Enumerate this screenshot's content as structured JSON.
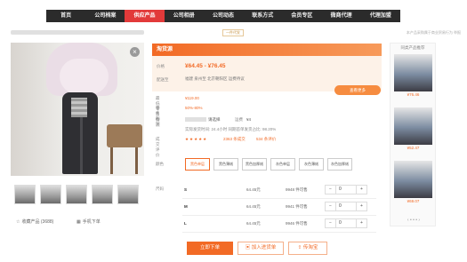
{
  "nav": {
    "items": [
      "首页",
      "公司档案",
      "供应产品",
      "公司相册",
      "公司动态",
      "联系方式",
      "会员专区",
      "微商代理",
      "代理加盟"
    ],
    "active_index": 2,
    "active_color": "#e23a3a",
    "bar_color": "#2b2b2b"
  },
  "breadcrumb": {
    "brand_tag": "一件代发",
    "right_text": "本产品采购属于商业贸易行为    举报"
  },
  "product": {
    "title": "淘货源",
    "price_label": "价格",
    "price": "¥64.45 - ¥76.45",
    "ship_label": "配送至",
    "ship_text": "福建 泉州至 北京朝阳区 运费待议",
    "see_more": "查看更多",
    "close_icon": "close-icon",
    "accent_color": "#f26a25"
  },
  "info_rows": {
    "min_price_label": "最低零售价",
    "min_price_value": "¥119.00",
    "margin_label": "零售利润",
    "margin_value": "50%-80%",
    "stock_label": "物流",
    "stock_value": "请选择",
    "freight_label": "运费",
    "freight_value": "¥4",
    "ship_speed": "实际发货时间: 24.4小时    同期首单发货占比: 98.20%",
    "rating_label": "成交评价",
    "rating_stars": "★★★★★",
    "sold_count": "2363 条成交",
    "review_count": "534 条评价"
  },
  "colors": {
    "label": "颜色",
    "options": [
      "黑色单层",
      "黑色薄绒",
      "黑色加厚绒",
      "灰色单层",
      "灰色薄绒",
      "灰色加厚绒"
    ],
    "selected_index": 0
  },
  "sizes": {
    "label": "尺码",
    "rows": [
      {
        "size": "S",
        "price": "64.45元",
        "stock": "9948 件可售",
        "qty": "0"
      },
      {
        "size": "M",
        "price": "64.45元",
        "stock": "9941 件可售",
        "qty": "0"
      },
      {
        "size": "L",
        "price": "64.45元",
        "stock": "9946 件可售",
        "qty": "0"
      }
    ],
    "minus": "−",
    "plus": "+"
  },
  "actions": {
    "buy": "立即下单",
    "cart": "加入进货单",
    "share": "传淘宝"
  },
  "gallery": {
    "favorite": "收藏产品 (3688)",
    "mobile": "手机下单"
  },
  "sidebar": {
    "title": "同类产品推荐",
    "items": [
      {
        "price": "¥76.46"
      },
      {
        "price": "¥52.47"
      },
      {
        "price": "¥69.07"
      }
    ],
    "pager": "‹ • • • ›"
  }
}
